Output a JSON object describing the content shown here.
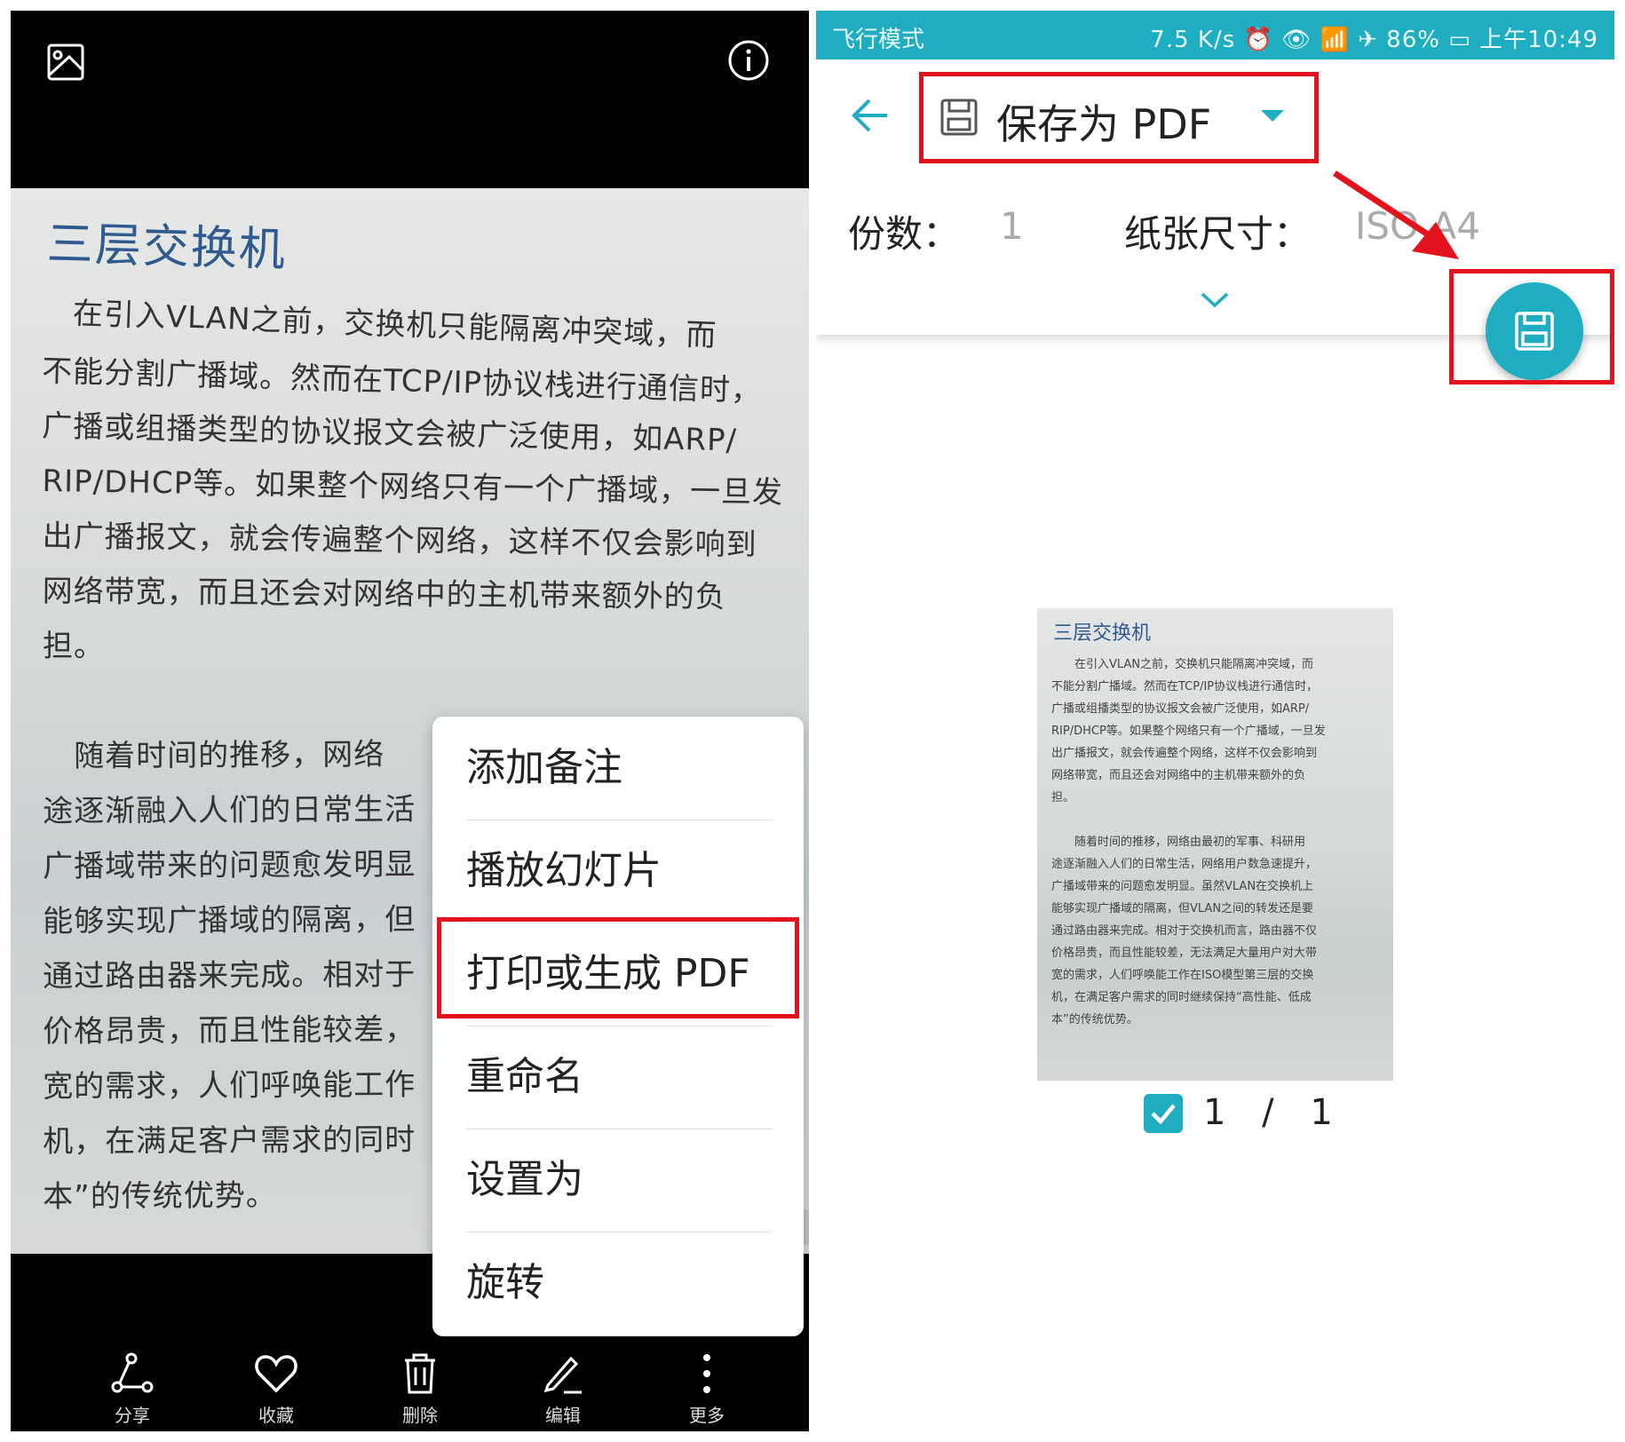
{
  "left": {
    "header_icons": [
      "image-icon",
      "info-icon"
    ],
    "photo": {
      "title": "三层交换机",
      "paragraph1": [
        "　在引入VLAN之前，交换机只能隔离冲突域，而",
        "不能分割广播域。然而在TCP/IP协议栈进行通信时，",
        "广播或组播类型的协议报文会被广泛使用，如ARP/",
        "RIP/DHCP等。如果整个网络只有一个广播域，一旦发",
        "出广播报文，就会传遍整个网络，这样不仅会影响到",
        "网络带宽，而且还会对网络中的主机带来额外的负",
        "担。"
      ],
      "paragraph2": [
        "　随着时间的推移，网络",
        "途逐渐融入人们的日常生活",
        "广播域带来的问题愈发明显",
        "能够实现广播域的隔离，但",
        "通过路由器来完成。相对于",
        "价格昂贵，而且性能较差，",
        "宽的需求，人们呼唤能工作",
        "机，在满足客户需求的同时",
        "本”的传统优势。"
      ]
    },
    "menu": {
      "items": [
        "添加备注",
        "播放幻灯片",
        "打印或生成 PDF",
        "重命名",
        "设置为",
        "旋转"
      ],
      "highlighted_index": 2
    },
    "toolbar": [
      {
        "label": "分享",
        "icon": "share-icon"
      },
      {
        "label": "收藏",
        "icon": "heart-icon"
      },
      {
        "label": "删除",
        "icon": "trash-icon"
      },
      {
        "label": "编辑",
        "icon": "edit-icon"
      },
      {
        "label": "更多",
        "icon": "more-icon"
      }
    ]
  },
  "right": {
    "status_bar": {
      "left": "飞行模式",
      "speed": "7.5 K/s",
      "battery": "86%",
      "time": "上午10:49"
    },
    "destination": "保存为 PDF",
    "copies_label": "份数：",
    "copies_value": "1",
    "paper_label": "纸张尺寸：",
    "paper_value": "ISO A4",
    "fab_icon": "save-icon",
    "thumbnail": {
      "title": "三层交换机",
      "lines": [
        "　　在引入VLAN之前，交换机只能隔离冲突域，而",
        "不能分割广播域。然而在TCP/IP协议栈进行通信时，",
        "广播或组播类型的协议报文会被广泛使用，如ARP/",
        "RIP/DHCP等。如果整个网络只有一个广播域，一旦发",
        "出广播报文，就会传遍整个网络，这样不仅会影响到",
        "网络带宽，而且还会对网络中的主机带来额外的负",
        "担。",
        "",
        "　　随着时间的推移，网络由最初的军事、科研用",
        "途逐渐融入人们的日常生活，网络用户数急速提升，",
        "广播域带来的问题愈发明显。虽然VLAN在交换机上",
        "能够实现广播域的隔离，但VLAN之间的转发还是要",
        "通过路由器来完成。相对于交换机而言，路由器不仅",
        "价格昂贵，而且性能较差，无法满足大量用户对大带",
        "宽的需求，人们呼唤能工作在ISO模型第三层的交换",
        "机，在满足客户需求的同时继续保持“高性能、低成",
        "本”的传统优势。"
      ]
    },
    "page_indicator": "1 / 1",
    "page_checked": true
  },
  "colors": {
    "accent": "#1eadc1",
    "highlight": "#e3131d",
    "title_blue": "#2f5a8f"
  }
}
